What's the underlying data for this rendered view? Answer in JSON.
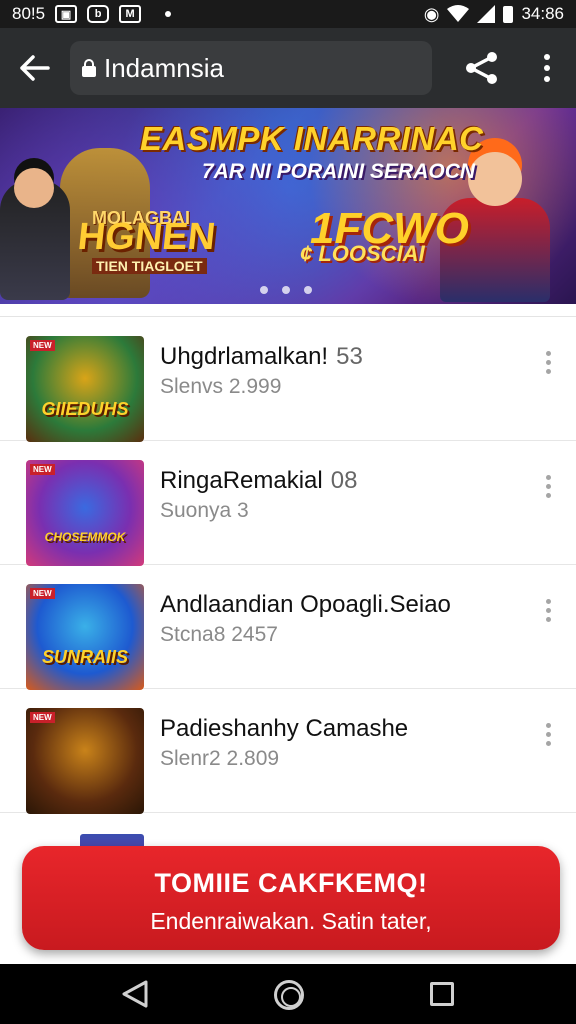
{
  "status_bar": {
    "time_left": "80!5",
    "time_right": "34:86",
    "icons": [
      "photo-icon",
      "bag-icon",
      "mail-icon",
      "location-icon",
      "wifi-icon",
      "signal-icon",
      "battery-icon"
    ]
  },
  "app_bar": {
    "url": "Indamnsia",
    "icons": [
      "back-arrow-icon",
      "lock-icon",
      "share-icon",
      "more-vert-icon"
    ]
  },
  "banner": {
    "title": "EASMPK INARRINAC",
    "subtitle": "7AR NI PORAINI SERAOCN",
    "logo_top": "MOLAGBAI",
    "logo_main": "HGNEN",
    "logo_bottom": "TIEN TIAGLOET",
    "big_text": "1FCWO",
    "tag_text": "¢ LOOSCIAI",
    "page_count": 3
  },
  "list": {
    "items": [
      {
        "title": "Uhgdrlamalkan!",
        "count": "53",
        "subtitle": "Slenvs 2.999",
        "thumb_label": "GIIEDUHS",
        "thumb_colors": [
          "#2c7a3a",
          "#d9a418",
          "#5a2e0e"
        ]
      },
      {
        "title": "RingaRemakial",
        "count": "08",
        "subtitle": "Suonya 3",
        "thumb_label": "CHOSEMMOK",
        "thumb_colors": [
          "#7a2fb0",
          "#3a6ae0",
          "#d23a7a"
        ]
      },
      {
        "title": "Andlaandian Opoagli.Seiao",
        "count": "",
        "subtitle": "Stcna8 2457",
        "thumb_label": "SUNRAIIS",
        "thumb_colors": [
          "#1e5ad0",
          "#3ab0e8",
          "#d85a1a"
        ]
      },
      {
        "title": "Padieshanhy Camashe",
        "count": "",
        "subtitle": "Slenr2 2.809",
        "thumb_label": "",
        "thumb_colors": [
          "#5a2a0e",
          "#c9831a",
          "#2a1606"
        ]
      }
    ]
  },
  "toast": {
    "title": "TOMIIE CAKFKEMQ!",
    "message": "Endenraiwakan. Satin tater,"
  },
  "nav_bar": {
    "icons": [
      "nav-back-icon",
      "nav-home-icon",
      "nav-recents-icon"
    ]
  }
}
